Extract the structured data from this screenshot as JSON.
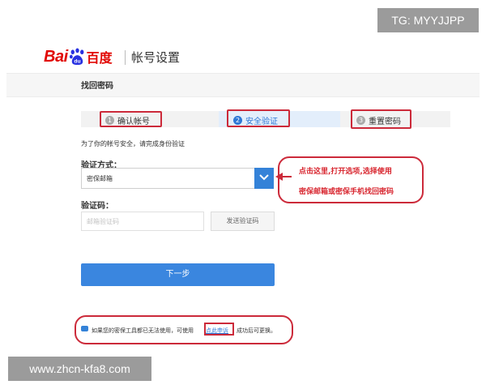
{
  "header": {
    "logo_bai": "Bai",
    "logo_du": "du",
    "logo_cn": "百度",
    "title": "帐号设置"
  },
  "page": {
    "subtitle": "找回密码"
  },
  "steps": [
    {
      "number": "1",
      "label": "确认帐号",
      "active": false
    },
    {
      "number": "2",
      "label": "安全验证",
      "active": true
    },
    {
      "number": "3",
      "label": "重置密码",
      "active": false
    }
  ],
  "form": {
    "notice": "为了你的帐号安全，请完成身份验证",
    "method_label": "验证方式：",
    "method_value": "密保邮箱",
    "code_label": "验证码：",
    "code_placeholder": "邮箱验证码",
    "send_code_label": "发送验证码",
    "next_label": "下一步"
  },
  "callout": {
    "line1": "点击这里,打开选项,选择使用",
    "line2": "密保邮箱或密保手机找回密码"
  },
  "footer": {
    "text_before": "如果您的密保工具都已无法使用，可使用",
    "link": "点此申诉",
    "text_after": "成功后可更换。"
  },
  "watermarks": {
    "top": "TG: MYYJJPP",
    "bottom": "www.zhcn-kfa8.com"
  },
  "colors": {
    "baidu_red": "#e10602",
    "primary_blue": "#3a86df",
    "annotation_red": "#cc2a3a"
  }
}
